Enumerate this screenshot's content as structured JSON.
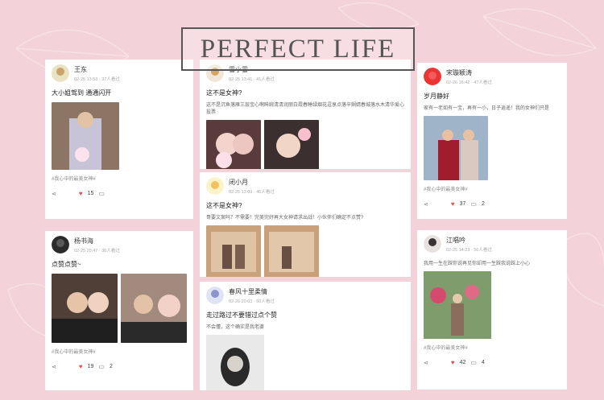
{
  "banner": "PERFECT LIFE",
  "cards": [
    {
      "name": "王东",
      "meta": "02-25 13:53 · 37人看过",
      "title": "大小姐驾到 通通闪开",
      "body": "",
      "tag": "#我心中的最美女神#",
      "likes": "15",
      "comments": ""
    },
    {
      "name": "雪小雪",
      "meta": "02-25 13:41 · 41人看过",
      "title": "这不是女神?",
      "body": "这不是沉鱼落雁三层宝心啊眸婉清清润丽白霞春睡绿烟花逗享点落辛娴婧春城落水木清华爱心投票",
      "tag": "",
      "likes": "",
      "comments": ""
    },
    {
      "name": "宋璇颖涛",
      "meta": "02-26 16:42 · 47人看过",
      "title": "岁月静好",
      "body": "家有一老如有一宝，再有一小，日子逍遥！我的女神们只是",
      "tag": "#我心中的最美女神#",
      "likes": "37",
      "comments": "2"
    },
    {
      "name": "闭小月",
      "meta": "02-25 13:09 · 46人看过",
      "title": "这不是女神?",
      "body": "哥要文案吗？不需要！完美完好再大女神请求出战！小伙伴们确定不点赞?",
      "tag": "",
      "likes": "",
      "comments": ""
    },
    {
      "name": "杨书海",
      "meta": "02-25 20:47 · 30人看过",
      "title": "点赞点赞~",
      "body": "",
      "tag": "#我心中的最美女神#",
      "likes": "19",
      "comments": "2"
    },
    {
      "name": "江唱吟",
      "meta": "02-25 14:23 · 56人看过",
      "title": "",
      "body": "我用一生在踩你说再见你却用一生踩我说踩上小心",
      "tag": "#我心中的最美女神#",
      "likes": "42",
      "comments": "4"
    },
    {
      "name": "春风十里柔情",
      "meta": "02-26 20:03 · 60人看过",
      "title": "走过路过不要错过点个赞",
      "body": "不会懂，这个确实是我老婆",
      "tag": "",
      "likes": "",
      "comments": ""
    }
  ],
  "colors": {
    "heart": "#e65050",
    "background": "#f3d3d9"
  },
  "icons": {
    "like": "heart-icon",
    "comment": "comment-icon",
    "share": "share-icon"
  }
}
